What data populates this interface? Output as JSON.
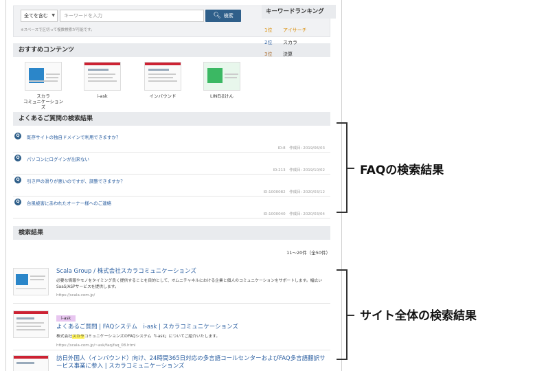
{
  "search": {
    "scope_value": "全てを含む",
    "keyword_placeholder": "キーワードを入力",
    "button_label": "検索",
    "hint": "※スペースで区切って複数検索が可能です。"
  },
  "ranking": {
    "title": "キーワードランキング",
    "items": [
      {
        "rank": "1位",
        "keyword": "アイサーチ",
        "color": "#d98a00"
      },
      {
        "rank": "2位",
        "keyword": "スカラ",
        "color": "#2a5ea0"
      },
      {
        "rank": "3位",
        "keyword": "決算",
        "color": "#a86a2a"
      }
    ]
  },
  "recommended": {
    "title": "おすすめコンテンツ",
    "items": [
      {
        "label": "スカラ\nコミュニケーションズ"
      },
      {
        "label": "i-ask"
      },
      {
        "label": "インバウンド"
      },
      {
        "label": "LINEほけん"
      }
    ]
  },
  "faq": {
    "title": "よくあるご質問の検索結果",
    "items": [
      {
        "question": "既存サイトの独自ドメインで利用できますか？",
        "id": "ID:8",
        "created": "作成日: 2019/06/03"
      },
      {
        "question": "パソコンにログインが出来ない",
        "id": "ID:213",
        "created": "作成日: 2019/10/02"
      },
      {
        "question": "引き戸の滑りが悪いのですが、調整できますか？",
        "id": "ID:1000082",
        "created": "作成日: 2020/03/12"
      },
      {
        "question": "台風被害にあわれたオーナー様へのご連絡",
        "id": "ID:1000040",
        "created": "作成日: 2020/03/04"
      }
    ]
  },
  "results": {
    "title": "検索結果",
    "count": "11〜20件（全50件）",
    "items": [
      {
        "tag": "",
        "title": "Scala Group / 株式会社スカラコミュニケーションズ",
        "snippet": "必要な情報やモノをタイミング良く提供することを目的として、オムニチャネルにおける企業と個人のコミュニケーションをサポートします。幅広いSaaS/ASPサービスを提供します。",
        "url": "https://scala-com.jp/"
      },
      {
        "tag": "i-ask",
        "title": "よくあるご質問 | FAQシステム　i-ask | スカラコミュニケーションズ",
        "snippet_pre": "株式会社",
        "snippet_hl": "スカラ",
        "snippet_post": "コミュニケーションズのFAQシステム「i-ask」についてご紹介いたします。",
        "url": "https://scala-com.jp/~ask/faq/faq_08.html"
      },
      {
        "tag": "",
        "title": "訪日外国人（インバウンド）向け、24時間365日対応の多言語コールセンターおよびFAQ多言語翻訳サービス事業に参入 | スカラコミュニケーションズ",
        "snippet": "",
        "url": ""
      }
    ]
  },
  "annotations": {
    "faq_label": "FAQの検索結果",
    "site_label": "サイト全体の検索結果"
  }
}
